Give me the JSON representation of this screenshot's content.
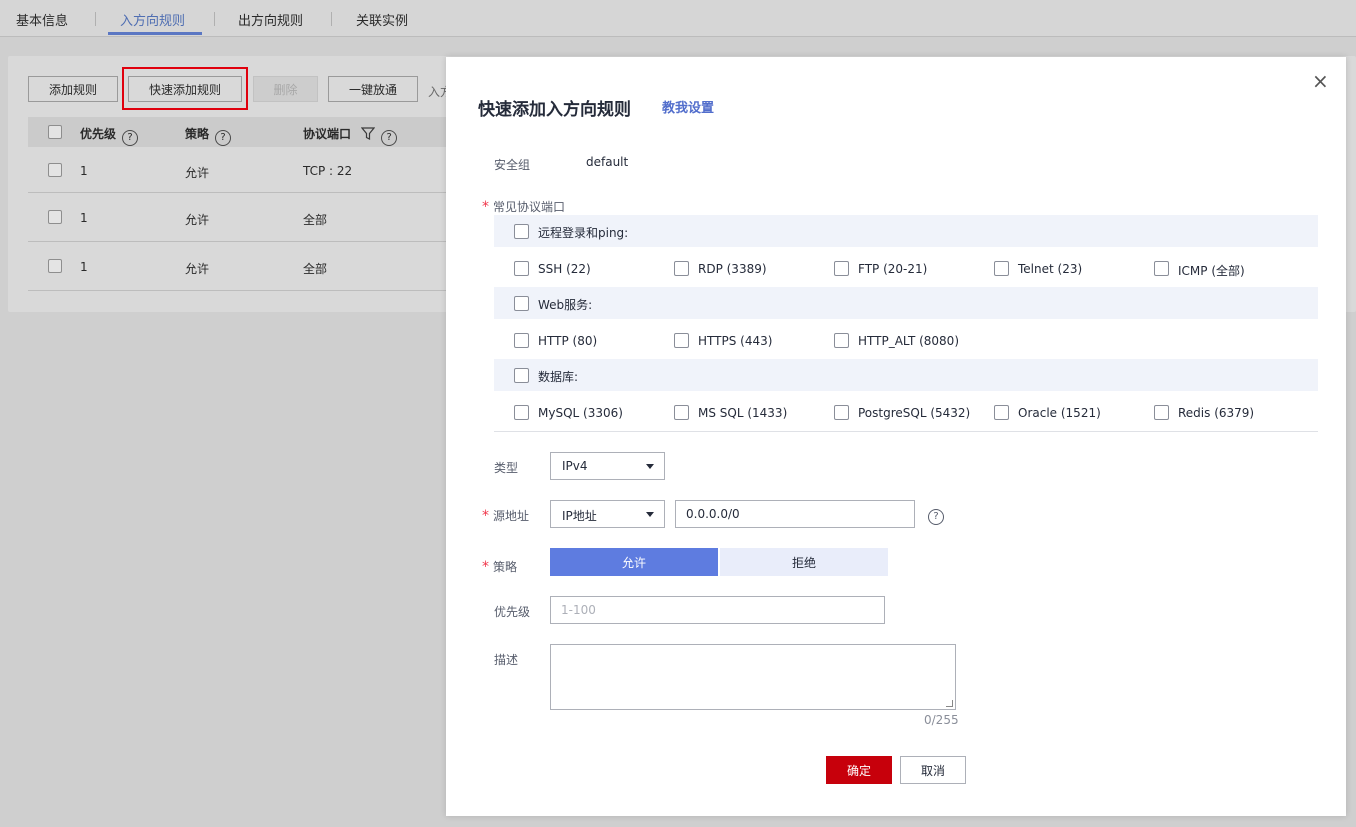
{
  "tabs": [
    {
      "label": "基本信息"
    },
    {
      "label": "入方向规则"
    },
    {
      "label": "出方向规则"
    },
    {
      "label": "关联实例"
    }
  ],
  "toolbar": {
    "add_rule": "添加规则",
    "quick_add_rule": "快速添加规则",
    "delete": "删除",
    "allow_all": "一键放通",
    "hint": "入方"
  },
  "table": {
    "headers": {
      "priority": "优先级",
      "policy": "策略",
      "protocol_port": "协议端口"
    },
    "rows": [
      {
        "priority": "1",
        "policy": "允许",
        "protocol_port": "TCP : 22"
      },
      {
        "priority": "1",
        "policy": "允许",
        "protocol_port": "全部"
      },
      {
        "priority": "1",
        "policy": "允许",
        "protocol_port": "全部"
      }
    ]
  },
  "dialog": {
    "title": "快速添加入方向规则",
    "help_link": "教我设置",
    "security_group_label": "安全组",
    "security_group_value": "default",
    "common_ports_label": "常见协议端口",
    "groups": {
      "remote": {
        "title": "远程登录和ping:",
        "options": [
          "SSH (22)",
          "RDP (3389)",
          "FTP (20-21)",
          "Telnet (23)",
          "ICMP (全部)"
        ]
      },
      "web": {
        "title": "Web服务:",
        "options": [
          "HTTP (80)",
          "HTTPS (443)",
          "HTTP_ALT (8080)"
        ]
      },
      "db": {
        "title": "数据库:",
        "options": [
          "MySQL (3306)",
          "MS SQL (1433)",
          "PostgreSQL (5432)",
          "Oracle (1521)",
          "Redis (6379)"
        ]
      }
    },
    "type_label": "类型",
    "type_value": "IPv4",
    "source_label": "源地址",
    "source_type_value": "IP地址",
    "source_address_value": "0.0.0.0/0",
    "policy_label": "策略",
    "policy_allow": "允许",
    "policy_deny": "拒绝",
    "priority_label": "优先级",
    "priority_placeholder": "1-100",
    "description_label": "描述",
    "description_counter": "0/255",
    "confirm": "确定",
    "cancel": "取消",
    "close_glyph": "×"
  }
}
